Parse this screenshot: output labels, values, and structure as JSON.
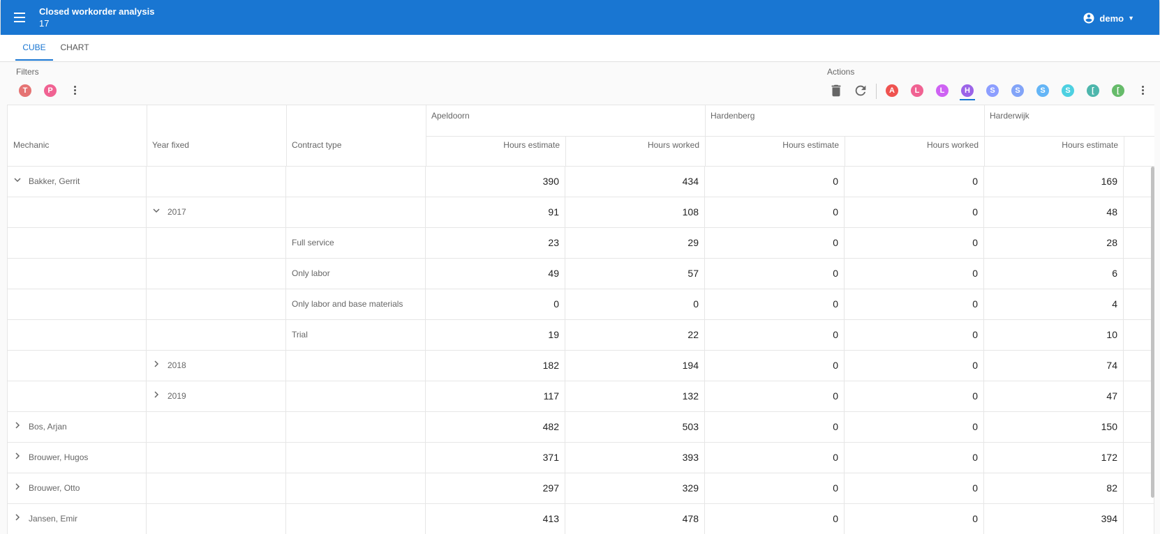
{
  "appbar": {
    "title": "Closed workorder analysis",
    "subtitle": "17",
    "user": "demo"
  },
  "tabs": [
    {
      "label": "CUBE"
    },
    {
      "label": "CHART"
    }
  ],
  "filters": {
    "label": "Filters",
    "chips": [
      {
        "letter": "T",
        "color": "#e57373"
      },
      {
        "letter": "P",
        "color": "#f06292"
      }
    ]
  },
  "actions": {
    "label": "Actions",
    "chips": [
      {
        "letter": "A",
        "color": "#ef5350"
      },
      {
        "letter": "L",
        "color": "#f06292"
      },
      {
        "letter": "L",
        "color": "#ce62f3"
      },
      {
        "letter": "H",
        "color": "#9c64e8"
      },
      {
        "letter": "S",
        "color": "#8c9eff"
      },
      {
        "letter": "S",
        "color": "#82a4f8"
      },
      {
        "letter": "S",
        "color": "#64b5f6"
      },
      {
        "letter": "S",
        "color": "#4dd0e1"
      },
      {
        "letter": "[",
        "color": "#4db6ac"
      },
      {
        "letter": "[",
        "color": "#66bb6a"
      }
    ]
  },
  "grid": {
    "row_headers": [
      "Mechanic",
      "Year fixed",
      "Contract type"
    ],
    "locations": [
      "Apeldoorn",
      "Hardenberg",
      "Harderwijk"
    ],
    "measures": [
      "Hours estimate",
      "Hours worked",
      "Hours estimate",
      "Hours worked",
      "Hours estimate"
    ],
    "rows": [
      {
        "mechanic": "Bakker, Gerrit",
        "year": "",
        "contract": "",
        "toggle": "expanded",
        "level": 0,
        "values": [
          "390",
          "434",
          "0",
          "0",
          "169"
        ]
      },
      {
        "mechanic": "",
        "year": "2017",
        "contract": "",
        "toggle": "expanded",
        "level": 1,
        "values": [
          "91",
          "108",
          "0",
          "0",
          "48"
        ]
      },
      {
        "mechanic": "",
        "year": "",
        "contract": "Full service",
        "toggle": "none",
        "level": 2,
        "values": [
          "23",
          "29",
          "0",
          "0",
          "28"
        ]
      },
      {
        "mechanic": "",
        "year": "",
        "contract": "Only labor",
        "toggle": "none",
        "level": 2,
        "values": [
          "49",
          "57",
          "0",
          "0",
          "6"
        ]
      },
      {
        "mechanic": "",
        "year": "",
        "contract": "Only labor and base materials",
        "toggle": "none",
        "level": 2,
        "values": [
          "0",
          "0",
          "0",
          "0",
          "4"
        ]
      },
      {
        "mechanic": "",
        "year": "",
        "contract": "Trial",
        "toggle": "none",
        "level": 2,
        "values": [
          "19",
          "22",
          "0",
          "0",
          "10"
        ]
      },
      {
        "mechanic": "",
        "year": "2018",
        "contract": "",
        "toggle": "collapsed",
        "level": 1,
        "values": [
          "182",
          "194",
          "0",
          "0",
          "74"
        ]
      },
      {
        "mechanic": "",
        "year": "2019",
        "contract": "",
        "toggle": "collapsed",
        "level": 1,
        "values": [
          "117",
          "132",
          "0",
          "0",
          "47"
        ]
      },
      {
        "mechanic": "Bos, Arjan",
        "year": "",
        "contract": "",
        "toggle": "collapsed",
        "level": 0,
        "values": [
          "482",
          "503",
          "0",
          "0",
          "150"
        ]
      },
      {
        "mechanic": "Brouwer, Hugos",
        "year": "",
        "contract": "",
        "toggle": "collapsed",
        "level": 0,
        "values": [
          "371",
          "393",
          "0",
          "0",
          "172"
        ]
      },
      {
        "mechanic": "Brouwer, Otto",
        "year": "",
        "contract": "",
        "toggle": "collapsed",
        "level": 0,
        "values": [
          "297",
          "329",
          "0",
          "0",
          "82"
        ]
      },
      {
        "mechanic": "Jansen, Emir",
        "year": "",
        "contract": "",
        "toggle": "collapsed",
        "level": 0,
        "values": [
          "413",
          "478",
          "0",
          "0",
          "394"
        ]
      }
    ]
  }
}
